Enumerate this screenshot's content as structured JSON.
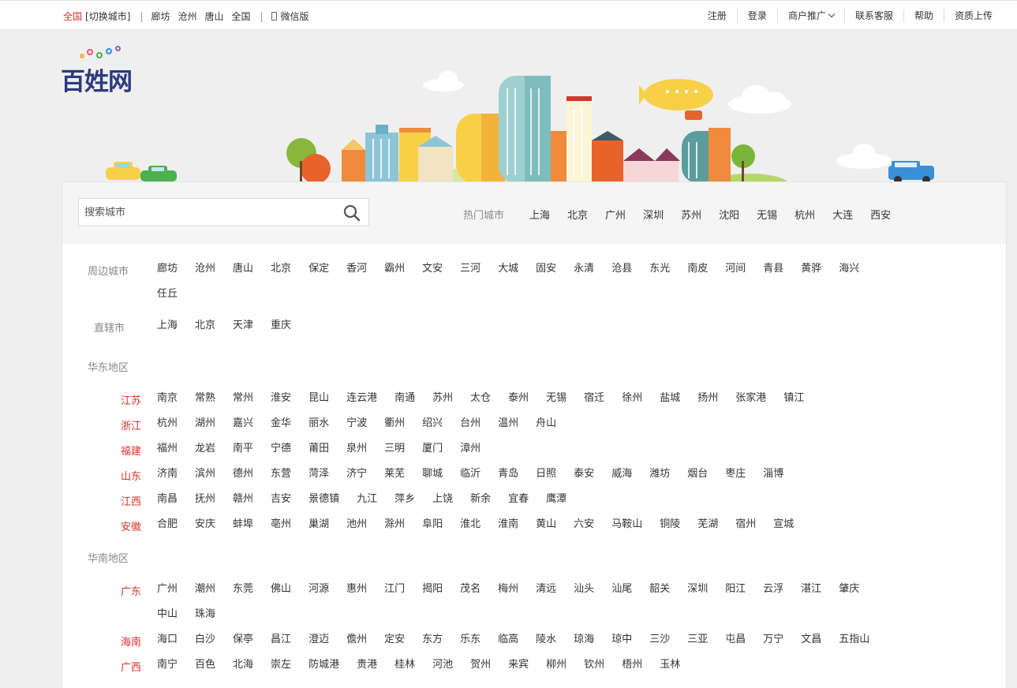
{
  "topbar": {
    "current_city": "全国",
    "switch_label": "[切换城市]",
    "quick_cities": [
      "廊坊",
      "沧州",
      "唐山",
      "全国"
    ],
    "wechat_label": "微信版",
    "links": [
      "注册",
      "登录",
      "商户推广",
      "联系客服",
      "帮助",
      "资质上传"
    ]
  },
  "logo": {
    "text": "百姓网"
  },
  "search": {
    "placeholder": "搜索城市"
  },
  "hot_cities": {
    "label": "热门城市",
    "items": [
      "上海",
      "北京",
      "广州",
      "深圳",
      "苏州",
      "沈阳",
      "无锡",
      "杭州",
      "大连",
      "西安"
    ]
  },
  "nearby": {
    "label": "周边城市",
    "cities": [
      "廊坊",
      "沧州",
      "唐山",
      "北京",
      "保定",
      "香河",
      "霸州",
      "文安",
      "三河",
      "大城",
      "固安",
      "永清",
      "沧县",
      "东光",
      "南皮",
      "河间",
      "青县",
      "黄骅",
      "海兴",
      "任丘"
    ]
  },
  "municipalities": {
    "label": "直辖市",
    "cities": [
      "上海",
      "北京",
      "天津",
      "重庆"
    ]
  },
  "regions": [
    {
      "name": "华东地区",
      "provinces": [
        {
          "name": "江苏",
          "cities": [
            "南京",
            "常熟",
            "常州",
            "淮安",
            "昆山",
            "连云港",
            "南通",
            "苏州",
            "太仓",
            "泰州",
            "无锡",
            "宿迁",
            "徐州",
            "盐城",
            "扬州",
            "张家港",
            "镇江"
          ]
        },
        {
          "name": "浙江",
          "cities": [
            "杭州",
            "湖州",
            "嘉兴",
            "金华",
            "丽水",
            "宁波",
            "衢州",
            "绍兴",
            "台州",
            "温州",
            "舟山"
          ]
        },
        {
          "name": "福建",
          "cities": [
            "福州",
            "龙岩",
            "南平",
            "宁德",
            "莆田",
            "泉州",
            "三明",
            "厦门",
            "漳州"
          ]
        },
        {
          "name": "山东",
          "cities": [
            "济南",
            "滨州",
            "德州",
            "东营",
            "菏泽",
            "济宁",
            "莱芜",
            "聊城",
            "临沂",
            "青岛",
            "日照",
            "泰安",
            "威海",
            "潍坊",
            "烟台",
            "枣庄",
            "淄博"
          ]
        },
        {
          "name": "江西",
          "cities": [
            "南昌",
            "抚州",
            "赣州",
            "吉安",
            "景德镇",
            "九江",
            "萍乡",
            "上饶",
            "新余",
            "宜春",
            "鹰潭"
          ]
        },
        {
          "name": "安徽",
          "cities": [
            "合肥",
            "安庆",
            "蚌埠",
            "亳州",
            "巢湖",
            "池州",
            "滁州",
            "阜阳",
            "淮北",
            "淮南",
            "黄山",
            "六安",
            "马鞍山",
            "铜陵",
            "芜湖",
            "宿州",
            "宣城"
          ]
        }
      ]
    },
    {
      "name": "华南地区",
      "provinces": [
        {
          "name": "广东",
          "cities": [
            "广州",
            "潮州",
            "东莞",
            "佛山",
            "河源",
            "惠州",
            "江门",
            "揭阳",
            "茂名",
            "梅州",
            "清远",
            "汕头",
            "汕尾",
            "韶关",
            "深圳",
            "阳江",
            "云浮",
            "湛江",
            "肇庆",
            "中山",
            "珠海"
          ]
        },
        {
          "name": "海南",
          "cities": [
            "海口",
            "白沙",
            "保亭",
            "昌江",
            "澄迈",
            "儋州",
            "定安",
            "东方",
            "乐东",
            "临高",
            "陵水",
            "琼海",
            "琼中",
            "三沙",
            "三亚",
            "屯昌",
            "万宁",
            "文昌",
            "五指山"
          ]
        },
        {
          "name": "广西",
          "cities": [
            "南宁",
            "百色",
            "北海",
            "崇左",
            "防城港",
            "贵港",
            "桂林",
            "河池",
            "贺州",
            "来宾",
            "柳州",
            "钦州",
            "梧州",
            "玉林"
          ]
        }
      ]
    }
  ],
  "icons": {
    "search": "search-icon",
    "phone": "phone-icon",
    "dropdown": "chevron-down-icon"
  },
  "colors": {
    "accent_red": "#d9322b",
    "logo_blue": "#2d3a7d"
  }
}
